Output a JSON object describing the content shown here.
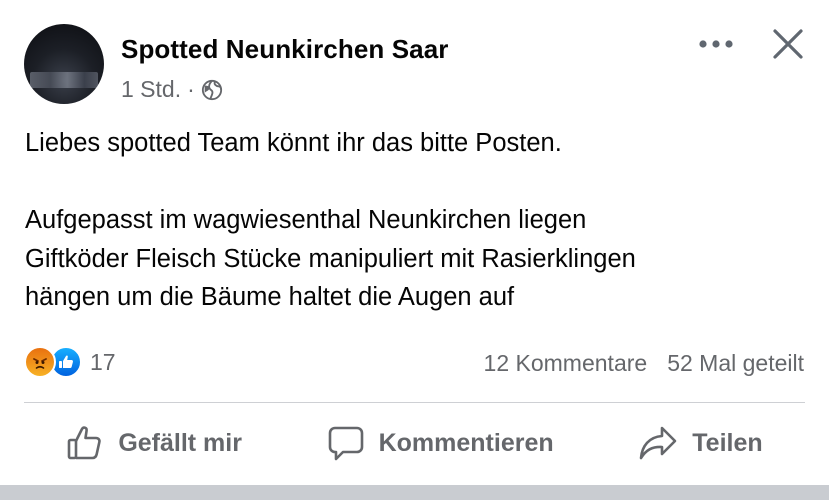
{
  "post": {
    "page_name": "Spotted Neunkirchen Saar",
    "timestamp": "1 Std.",
    "separator": "·",
    "privacy_icon": "globe-icon",
    "more_icon": "more-horizontal-icon",
    "close_icon": "close-icon",
    "text_lines": [
      "Liebes spotted Team könnt ihr das bitte Posten.",
      "",
      "Aufgepasst im wagwiesenthal Neunkirchen liegen",
      "Giftköder Fleisch Stücke manipuliert mit Rasierklingen",
      "hängen um die Bäume haltet die Augen auf"
    ]
  },
  "reactions": {
    "types": [
      "angry",
      "like"
    ],
    "count": "17"
  },
  "stats": {
    "comments": "12 Kommentare",
    "shares": "52 Mal geteilt"
  },
  "actions": {
    "like_label": "Gefällt mir",
    "comment_label": "Kommentieren",
    "share_label": "Teilen"
  },
  "colors": {
    "secondary_text": "#65676b",
    "primary_text": "#050505",
    "divider": "#ced0d4",
    "angry_orange": "#e9710f",
    "like_blue": "#0062df"
  }
}
